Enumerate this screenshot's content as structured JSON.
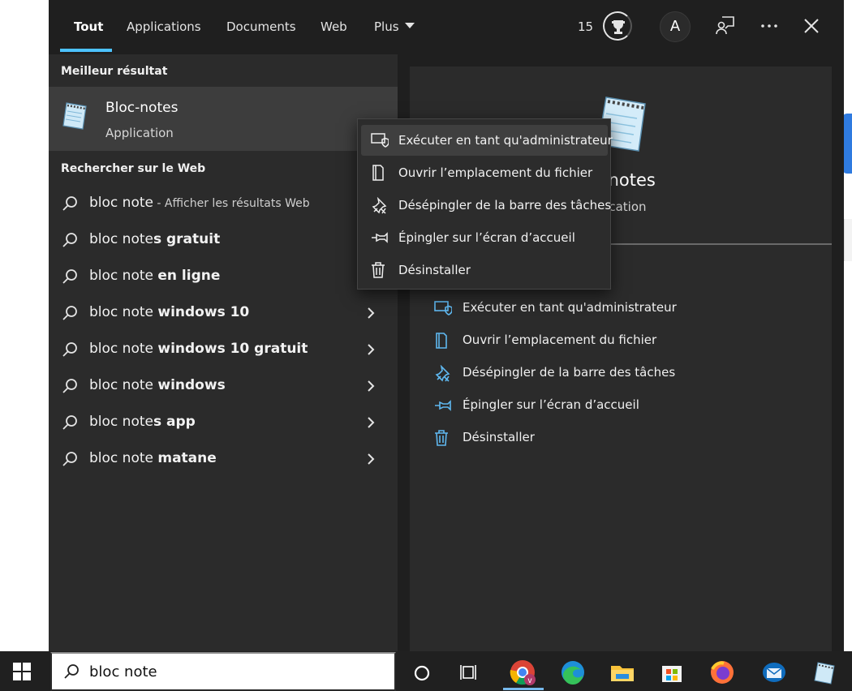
{
  "tabs": [
    {
      "label": "Tout",
      "active": true
    },
    {
      "label": "Applications"
    },
    {
      "label": "Documents"
    },
    {
      "label": "Web"
    },
    {
      "label": "Plus"
    }
  ],
  "topbar": {
    "reward_count": "15",
    "avatar_initial": "A",
    "icons": [
      "rewards-trophy-icon",
      "feedback-icon",
      "more-options-icon",
      "close-icon"
    ]
  },
  "left": {
    "best_match_heading": "Meilleur résultat",
    "best_match": {
      "name": "Bloc-notes",
      "type": "Application",
      "icon": "notepad-app-icon"
    },
    "web_heading": "Rechercher sur le Web",
    "web_items": [
      {
        "prefix": "bloc note",
        "bold": "",
        "sub": " - Afficher les résultats Web",
        "chevron": false
      },
      {
        "prefix": "bloc note",
        "bold": "s gratuit",
        "sub": "",
        "chevron": false
      },
      {
        "prefix": "bloc note ",
        "bold": "en ligne",
        "sub": "",
        "chevron": false
      },
      {
        "prefix": "bloc note ",
        "bold": "windows 10",
        "sub": "",
        "chevron": true
      },
      {
        "prefix": "bloc note ",
        "bold": "windows 10 gratuit",
        "sub": "",
        "chevron": true
      },
      {
        "prefix": "bloc note ",
        "bold": "windows",
        "sub": "",
        "chevron": true
      },
      {
        "prefix": "bloc note",
        "bold": "s app",
        "sub": "",
        "chevron": true
      },
      {
        "prefix": "bloc note ",
        "bold": "matane",
        "sub": "",
        "chevron": true
      }
    ]
  },
  "right": {
    "name_visible": "-notes",
    "type_visible": "lication",
    "actions": [
      {
        "label": "Exécuter en tant qu'administrateur",
        "icon": "run-as-admin-shield-icon"
      },
      {
        "label": "Ouvrir l’emplacement du fichier",
        "icon": "open-file-location-icon"
      },
      {
        "label": "Désépingler de la barre des tâches",
        "icon": "unpin-taskbar-icon"
      },
      {
        "label": "Épingler sur l’écran d’accueil",
        "icon": "pin-start-icon"
      },
      {
        "label": "Désinstaller",
        "icon": "trash-icon"
      }
    ]
  },
  "context_menu": {
    "items": [
      {
        "label": "Exécuter en tant qu'administrateur",
        "hover": true
      },
      {
        "label": "Ouvrir l’emplacement du fichier"
      },
      {
        "label": "Désépingler de la barre des tâches"
      },
      {
        "label": "Épingler sur l’écran d’accueil"
      },
      {
        "label": "Désinstaller"
      }
    ]
  },
  "taskbar": {
    "search_value": "bloc note",
    "apps": [
      "windows-start-icon",
      "cortana-icon",
      "task-view-icon",
      "chrome-icon",
      "edge-icon",
      "file-explorer-icon",
      "microsoft-store-icon",
      "firefox-icon",
      "mail-icon",
      "notepad-icon"
    ]
  },
  "colors": {
    "accent": "#4cc2ff",
    "panel_bg": "#1f1f1f",
    "pane_bg": "#2b2b2b",
    "selected_bg": "#3d3d3d"
  }
}
